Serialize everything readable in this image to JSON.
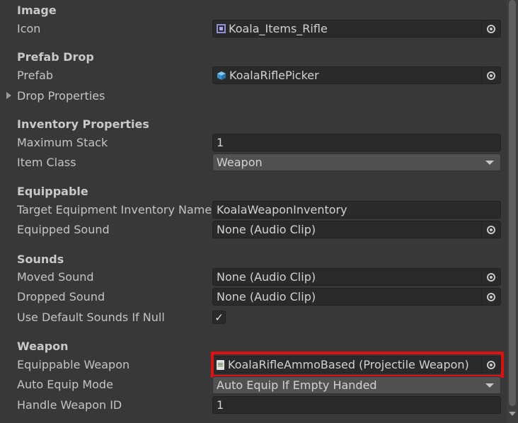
{
  "sections": {
    "image": {
      "header": "Image",
      "icon_label": "Icon",
      "icon_value": "Koala_Items_Rifle"
    },
    "prefab_drop": {
      "header": "Prefab Drop",
      "prefab_label": "Prefab",
      "prefab_value": "KoalaRiflePicker",
      "drop_properties_label": "Drop Properties"
    },
    "inventory": {
      "header": "Inventory Properties",
      "max_stack_label": "Maximum Stack",
      "max_stack_value": "1",
      "item_class_label": "Item Class",
      "item_class_value": "Weapon"
    },
    "equippable": {
      "header": "Equippable",
      "target_inventory_label": "Target Equipment Inventory Name",
      "target_inventory_value": "KoalaWeaponInventory",
      "equipped_sound_label": "Equipped Sound",
      "equipped_sound_value": "None (Audio Clip)"
    },
    "sounds": {
      "header": "Sounds",
      "moved_sound_label": "Moved Sound",
      "moved_sound_value": "None (Audio Clip)",
      "dropped_sound_label": "Dropped Sound",
      "dropped_sound_value": "None (Audio Clip)",
      "use_default_label": "Use Default Sounds If Null",
      "use_default_checked": true
    },
    "weapon": {
      "header": "Weapon",
      "equippable_weapon_label": "Equippable Weapon",
      "equippable_weapon_value": "KoalaRifleAmmoBased (Projectile Weapon)",
      "auto_equip_label": "Auto Equip Mode",
      "auto_equip_value": "Auto Equip If Empty Handed",
      "handle_weapon_id_label": "Handle Weapon ID",
      "handle_weapon_id_value": "1"
    }
  },
  "icons": {
    "object_picker": "object-picker-icon",
    "sprite": "sprite-icon",
    "prefab": "prefab-icon",
    "script": "script-icon",
    "checkmark": "✓"
  },
  "colors": {
    "background": "#383838",
    "field": "#2a2a2a",
    "highlight": "#e01010",
    "prefab_blue": "#4aa8e0"
  }
}
